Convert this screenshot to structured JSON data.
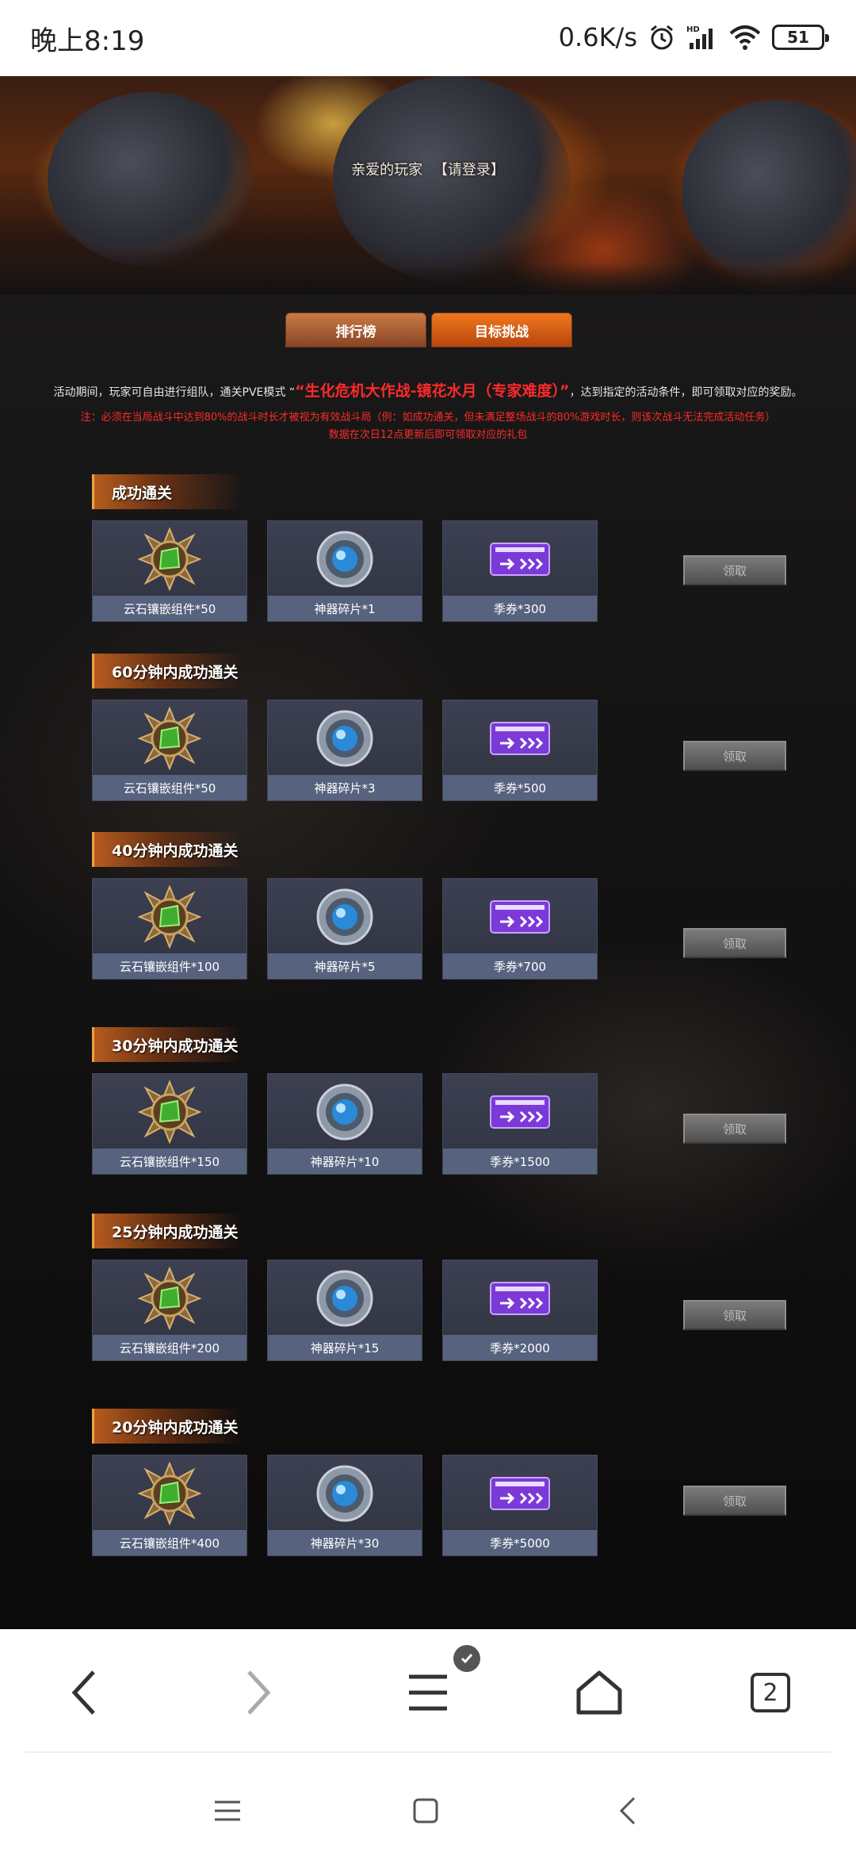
{
  "status_bar": {
    "time": "晚上8:19",
    "net_speed": "0.6K/s",
    "battery": "51"
  },
  "banner": {
    "greeting": "亲爱的玩家",
    "login": "【请登录】"
  },
  "tabs": [
    {
      "label": "排行榜"
    },
    {
      "label": "目标挑战"
    }
  ],
  "intro": {
    "prefix": "活动期间，玩家可自由进行组队，通关PVE模式 “",
    "highlight": "“生化危机大作战-镜花水月（专家难度）”",
    "suffix": "，达到指定的活动条件，即可领取对应的奖励。",
    "note_line1": "注：必须在当局战斗中达到80%的战斗时长才被视为有效战斗局（例：如成功通关，但未满足整场战斗的80%游戏时长，则该次战斗无法完成活动任务）",
    "note_line2": "数据在次日12点更新后即可领取对应的礼包"
  },
  "sections": [
    {
      "title": "成功通关",
      "rewards": [
        "云石镶嵌组件*50",
        "神器碎片*1",
        "季券*300"
      ],
      "claim": "领取"
    },
    {
      "title": "60分钟内成功通关",
      "rewards": [
        "云石镶嵌组件*50",
        "神器碎片*3",
        "季券*500"
      ],
      "claim": "领取"
    },
    {
      "title": "40分钟内成功通关",
      "rewards": [
        "云石镶嵌组件*100",
        "神器碎片*5",
        "季券*700"
      ],
      "claim": "领取"
    },
    {
      "title": "30分钟内成功通关",
      "rewards": [
        "云石镶嵌组件*150",
        "神器碎片*10",
        "季券*1500"
      ],
      "claim": "领取"
    },
    {
      "title": "25分钟内成功通关",
      "rewards": [
        "云石镶嵌组件*200",
        "神器碎片*15",
        "季券*2000"
      ],
      "claim": "领取"
    },
    {
      "title": "20分钟内成功通关",
      "rewards": [
        "云石镶嵌组件*400",
        "神器碎片*30",
        "季券*5000"
      ],
      "claim": "领取"
    }
  ],
  "browser": {
    "tab_count": "2"
  },
  "icons": {
    "reward_1": "gem-compass-icon",
    "reward_2": "artifact-orb-icon",
    "reward_3": "season-ticket-icon"
  },
  "colors": {
    "highlight_red": "#ff2a2a",
    "tab_orange": "#f0781e",
    "card_label_bg": "#56627e"
  }
}
